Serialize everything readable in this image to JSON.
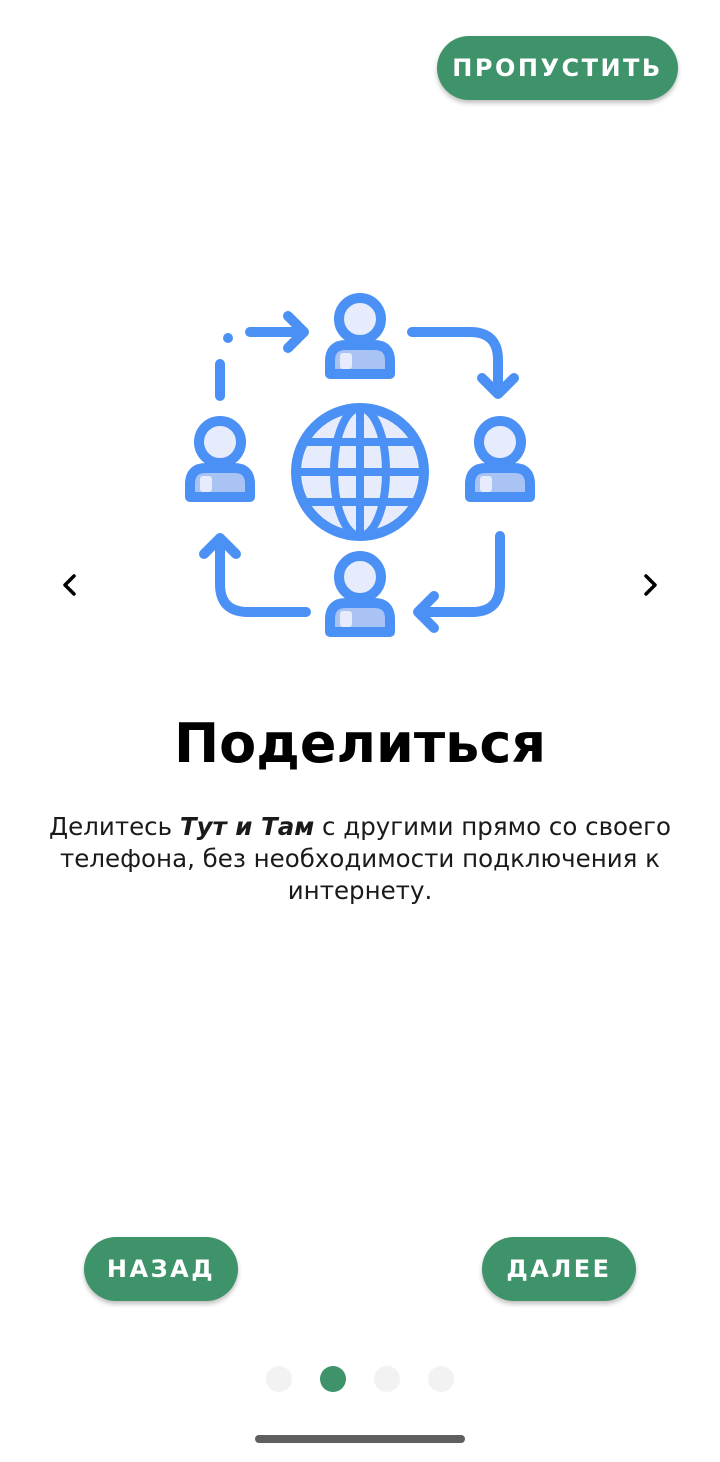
{
  "header": {
    "skip_label": "ПРОПУСТИТЬ"
  },
  "slide": {
    "illustration_icon": "share-network-icon",
    "title": "Поделиться",
    "description_before": "Делитесь ",
    "description_brand": "Тут и Там",
    "description_after": " с другими прямо со своего телефона, без необходимости подключения к интернету."
  },
  "navigation": {
    "prev_icon": "chevron-left-icon",
    "next_icon": "chevron-right-icon",
    "back_label": "НАЗАД",
    "next_label": "ДАЛЕЕ"
  },
  "pagination": {
    "total": 4,
    "current": 2
  },
  "colors": {
    "accent": "#3f936a",
    "illustration_primary": "#4a90f5",
    "illustration_light": "#e6ecfb",
    "illustration_mid": "#a9c3f5",
    "dot_inactive": "#f2f2f2"
  }
}
